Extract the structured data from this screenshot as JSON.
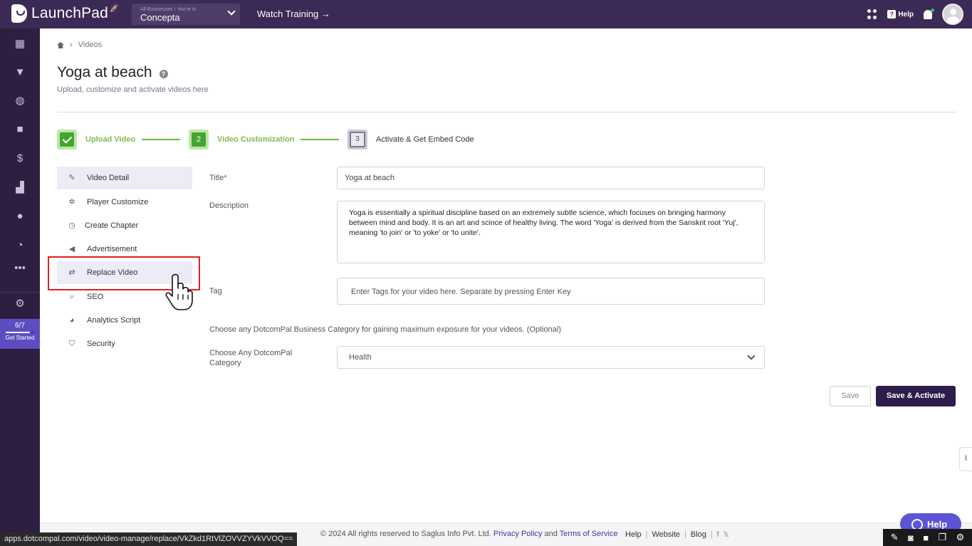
{
  "topbar": {
    "brand": "LaunchPad",
    "business_caption": "All Businesses › You're In",
    "business_name": "Concepta",
    "watch_training": "Watch Training →",
    "help_label": "Help"
  },
  "rail": {
    "progress_text": "6/7",
    "progress_fraction": 0.857,
    "get_started": "Get Started"
  },
  "breadcrumb": {
    "current": "Videos"
  },
  "page": {
    "title": "Yoga at beach",
    "subtitle": "Upload, customize and activate videos here"
  },
  "steps": [
    {
      "number": "1",
      "label": "Upload Video",
      "status": "done"
    },
    {
      "number": "2",
      "label": "Video Customization",
      "status": "done"
    },
    {
      "number": "3",
      "label": "Activate & Get Embed Code",
      "status": "current"
    }
  ],
  "menu": [
    {
      "label": "Video Detail",
      "icon": "edit-icon"
    },
    {
      "label": "Player Customize",
      "icon": "palette-icon"
    },
    {
      "label": "Create Chapter",
      "icon": "timer-icon"
    },
    {
      "label": "Advertisement",
      "icon": "megaphone-icon"
    },
    {
      "label": "Replace Video",
      "icon": "swap-icon"
    },
    {
      "label": "SEO",
      "icon": "magnifier-icon"
    },
    {
      "label": "Analytics Script",
      "icon": "analytics-icon"
    },
    {
      "label": "Security",
      "icon": "shield-icon"
    }
  ],
  "form": {
    "title_label": "Title",
    "title_required": "*",
    "title_value": "Yoga at beach",
    "description_label": "Description",
    "description_value": "Yoga is essentially a spiritual discipline based on an extremely subtle science, which focuses on bringing harmony between mind and body. It is an art and scince of healthy living. The word 'Yoga' is derived from the Sanskrit root 'Yuj', meaning 'to join' or 'to yoke' or 'to unite'.",
    "tag_label": "Tag",
    "tag_placeholder": "Enter Tags for your video here. Separate by pressing Enter Key",
    "category_hint": "Choose any DotcomPal Business Category for gaining maximum exposure for your videos. (Optional)",
    "category_label_line1": "Choose Any DotcomPal",
    "category_label_line2": "Category",
    "category_value": "Health"
  },
  "actions": {
    "save": "Save",
    "save_activate": "Save & Activate"
  },
  "footer": {
    "copyright": "© 2024 All rights reserved to Saglus Info Pvt. Ltd.",
    "privacy": "Privacy Policy",
    "and": "and",
    "terms": "Terms of Service",
    "links": [
      "Help",
      "Website",
      "Blog"
    ],
    "help_chat": "Help"
  },
  "status_url": "apps.dotcompal.com/video/video-manage/replace/VkZkd1RtVlZOVVZYVkVVOQ=="
}
